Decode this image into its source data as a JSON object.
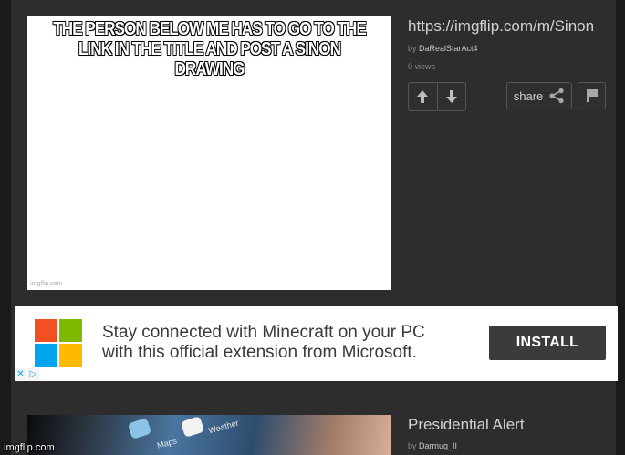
{
  "post1": {
    "caption_line1": "THE PERSON BELOW ME HAS TO GO TO THE",
    "caption_line2": "LINK IN THE TITLE AND POST A SINON DRAWING",
    "image_watermark": "imgflip.com",
    "title": "https://imgflip.com/m/Sinon",
    "by_label": "by",
    "author": "DaRealStarAct4",
    "views": "0 views",
    "share_label": "share"
  },
  "ad": {
    "text_line1": "Stay connected with Minecraft on your PC",
    "text_line2": "with this official extension from Microsoft.",
    "install_label": "INSTALL",
    "close_glyph": "✕",
    "adchoices_glyph": "▷",
    "logo_colors": [
      "#f25022",
      "#7fba00",
      "#00a4ef",
      "#ffb900"
    ]
  },
  "post2": {
    "title": "Presidential Alert",
    "by_label": "by",
    "author": "Darmug_II",
    "image_labels": {
      "maps": "Maps",
      "weather": "Weather"
    }
  },
  "footer_watermark": "imgflip.com",
  "icons": [
    "arrow-up-icon",
    "arrow-down-icon",
    "share-icon",
    "flag-icon",
    "microsoft-logo",
    "close-icon",
    "adchoices-icon"
  ]
}
